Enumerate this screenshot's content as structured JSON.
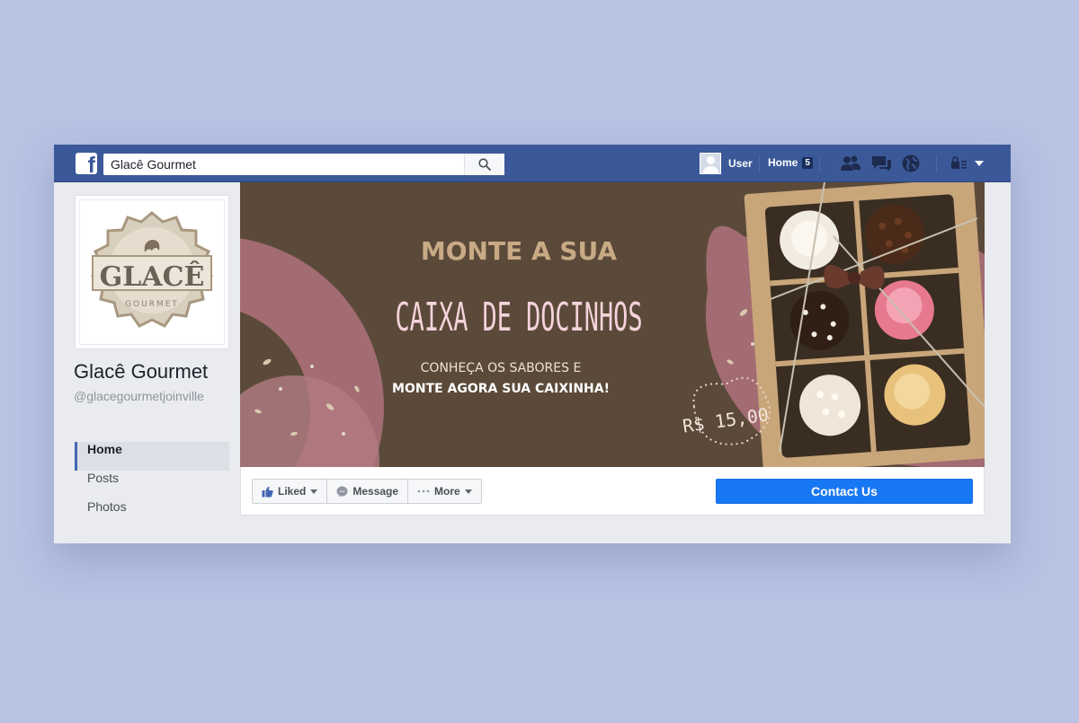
{
  "topbar": {
    "brand_letter": "f",
    "search_value": "Glacê Gourmet",
    "user_name": "User",
    "home_label": "Home",
    "home_badge": "5"
  },
  "page": {
    "name": "Glacê Gourmet",
    "handle": "@glacegourmetjoinville"
  },
  "logo": {
    "word": "GLACÊ",
    "sub": "GOURMET"
  },
  "nav": {
    "items": [
      {
        "label": "Home",
        "active": true
      },
      {
        "label": "Posts",
        "active": false
      },
      {
        "label": "Photos",
        "active": false
      }
    ]
  },
  "cover": {
    "line1": "MONTE A SUA",
    "line2": "CAIXA DE DOCINHOS",
    "line3": "CONHEÇA OS SABORES E",
    "line4": "MONTE AGORA SUA CAIXINHA!",
    "price": "R$ 15,00"
  },
  "actions": {
    "liked_label": "Liked",
    "message_label": "Message",
    "more_label": "More",
    "contact_label": "Contact Us"
  },
  "colors": {
    "topbar": "#3b5998",
    "cover_bg": "#5b4a3a",
    "accent_rose": "#a36b72",
    "title_tan": "#c8aa85",
    "contact_blue": "#1877f2"
  }
}
